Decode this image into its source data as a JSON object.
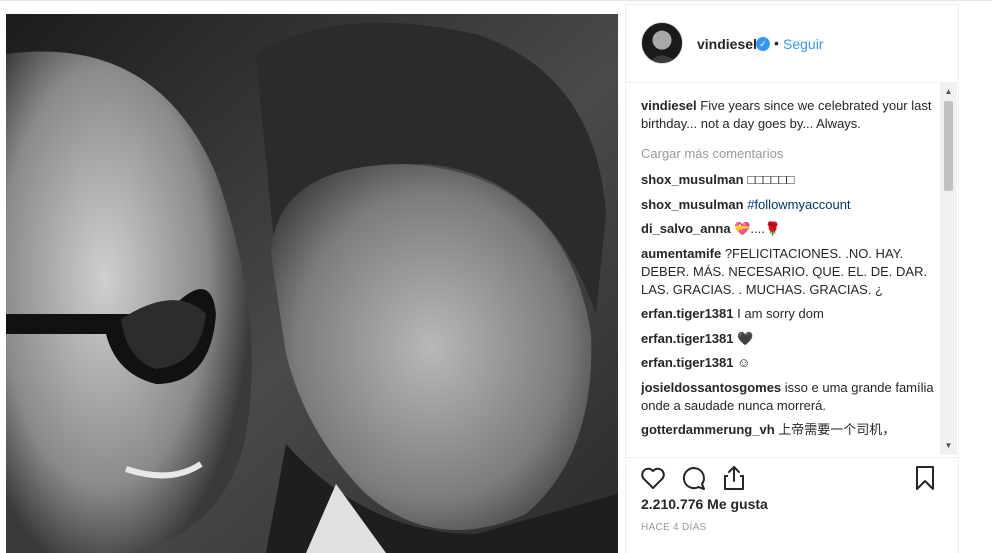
{
  "post": {
    "username": "vindiesel",
    "verified_mark": "✓",
    "separator": "•",
    "follow_label": "Seguir",
    "caption": {
      "username": "vindiesel",
      "text": "Five years since we celebrated your last birthday... not a day goes by... Always."
    },
    "load_more_label": "Cargar más comentarios",
    "comments": [
      {
        "username": "shox_musulman",
        "text": "□□□□□□"
      },
      {
        "username": "shox_musulman",
        "text": "#followmyaccount",
        "is_hashtag": true
      },
      {
        "username": "di_salvo_anna",
        "text": "💝....🌹"
      },
      {
        "username": "aumentamife",
        "text": "?FELICITACIONES. .NO. HAY. DEBER. MÁS. NECESARIO. QUE. EL. DE. DAR. LAS. GRACIAS. . MUCHAS. GRACIAS. ¿"
      },
      {
        "username": "erfan.tiger1381",
        "text": "I am sorry dom"
      },
      {
        "username": "erfan.tiger1381",
        "text": "🖤"
      },
      {
        "username": "erfan.tiger1381",
        "text": "☺"
      },
      {
        "username": "josieldossantosgomes",
        "text": "isso e uma grande família onde a saudade nunca morrerá."
      },
      {
        "username": "gotterdammerung_vh",
        "text": "上帝需要一个司机，"
      }
    ],
    "likes_label": "2.210.776 Me gusta",
    "time_label": "HACE 4 DÍAS",
    "icons": {
      "like": "heart-icon",
      "comment": "comment-bubble-icon",
      "share": "share-icon",
      "save": "bookmark-icon"
    },
    "colors": {
      "link": "#3897f0",
      "hashtag": "#003569",
      "muted": "#999999",
      "text": "#262626"
    }
  }
}
